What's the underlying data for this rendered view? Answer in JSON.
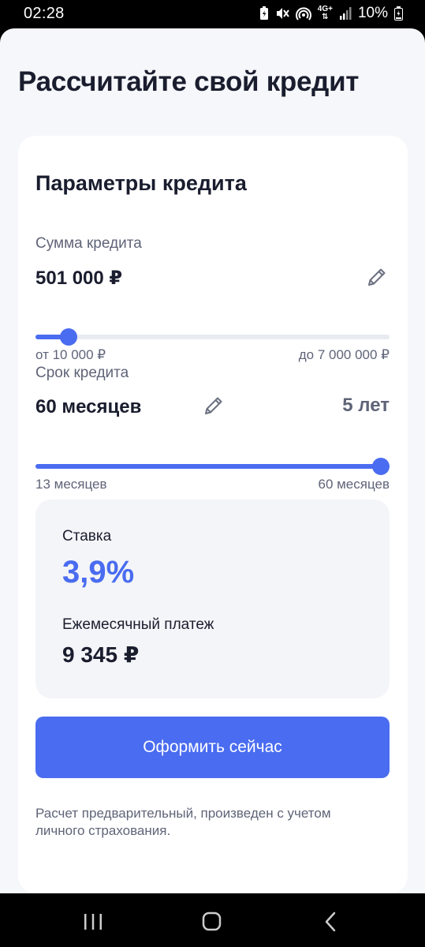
{
  "status_bar": {
    "time": "02:28",
    "network": "4G+",
    "battery": "10%",
    "icons": [
      "battery-saver-icon",
      "mute-icon",
      "hotspot-icon",
      "network-icon",
      "signal-icon",
      "battery-icon"
    ]
  },
  "page": {
    "title": "Рассчитайте свой кредит"
  },
  "card": {
    "title": "Параметры кредита",
    "amount": {
      "label": "Сумма кредита",
      "value": "501 000 ₽",
      "min_label": "от 10 000 ₽",
      "max_label": "до 7 000 000 ₽",
      "slider_fraction": 0.07
    },
    "term": {
      "label": "Срок кредита",
      "value": "60 месяцев",
      "years": "5 лет",
      "min_label": "13 месяцев",
      "max_label": "60 месяцев",
      "slider_fraction": 1.0
    },
    "result": {
      "rate_label": "Ставка",
      "rate_value": "3,9%",
      "payment_label": "Ежемесячный платеж",
      "payment_value": "9 345 ₽"
    },
    "cta_label": "Оформить сейчас",
    "footnote": "Расчет предварительный, произведен с учетом личного страхования."
  },
  "colors": {
    "accent": "#4a6cf0",
    "text": "#1a1d2e",
    "muted": "#5f6478",
    "background": "#f6f7fa"
  },
  "nav_bar": {
    "icons": [
      "recent-apps-icon",
      "home-icon",
      "back-icon"
    ]
  }
}
